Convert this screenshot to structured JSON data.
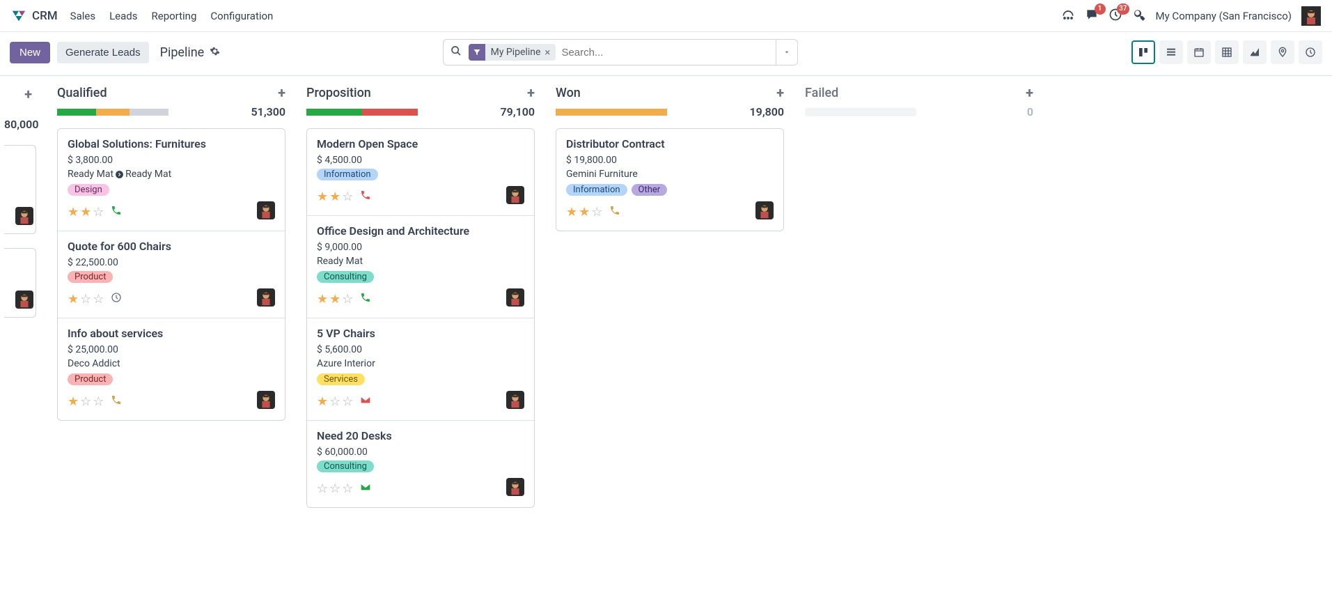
{
  "nav": {
    "app_title": "CRM",
    "links": [
      "Sales",
      "Leads",
      "Reporting",
      "Configuration"
    ],
    "messages_badge": "1",
    "activities_badge": "37",
    "company": "My Company (San Francisco)"
  },
  "control": {
    "new_label": "New",
    "generate_leads_label": "Generate Leads",
    "breadcrumb": "Pipeline",
    "filter_chip": "My Pipeline",
    "search_placeholder": "Search..."
  },
  "partial_col": {
    "total": "80,000"
  },
  "columns": [
    {
      "title": "Qualified",
      "total": "51,300",
      "bar": [
        {
          "color": "green",
          "w": "35%"
        },
        {
          "color": "orange",
          "w": "30%"
        },
        {
          "color": "gray",
          "w": "35%"
        }
      ],
      "cards": [
        {
          "title": "Global Solutions: Furnitures",
          "amount": "$ 3,800.00",
          "customer": "Ready Mat",
          "customer_extra": "Ready Mat",
          "has_external_icon": true,
          "tags": [
            {
              "cls": "tag-design",
              "label": "Design"
            }
          ],
          "stars": 2,
          "icon": "phone",
          "icon_color": "#28a745",
          "has_avatar": true
        },
        {
          "title": "Quote for 600 Chairs",
          "amount": "$ 22,500.00",
          "customer": "",
          "customer_extra": "",
          "has_external_icon": false,
          "tags": [
            {
              "cls": "tag-product",
              "label": "Product"
            }
          ],
          "stars": 1,
          "icon": "clock",
          "icon_color": "#6b7280",
          "has_avatar": true
        },
        {
          "title": "Info about services",
          "amount": "$ 25,000.00",
          "customer": "Deco Addict",
          "customer_extra": "",
          "has_external_icon": false,
          "tags": [
            {
              "cls": "tag-product",
              "label": "Product"
            }
          ],
          "stars": 1,
          "icon": "phone",
          "icon_color": "#d0a24c",
          "has_avatar": true
        }
      ]
    },
    {
      "title": "Proposition",
      "total": "79,100",
      "bar": [
        {
          "color": "green",
          "w": "50%"
        },
        {
          "color": "red",
          "w": "50%"
        }
      ],
      "cards": [
        {
          "title": "Modern Open Space",
          "amount": "$ 4,500.00",
          "customer": "",
          "customer_extra": "",
          "has_external_icon": false,
          "tags": [
            {
              "cls": "tag-info",
              "label": "Information"
            }
          ],
          "stars": 2,
          "icon": "phone",
          "icon_color": "#d9534f",
          "has_avatar": true
        },
        {
          "title": "Office Design and Architecture",
          "amount": "$ 9,000.00",
          "customer": "Ready Mat",
          "customer_extra": "",
          "has_external_icon": false,
          "tags": [
            {
              "cls": "tag-consulting",
              "label": "Consulting"
            }
          ],
          "stars": 2,
          "icon": "phone",
          "icon_color": "#28a745",
          "has_avatar": true
        },
        {
          "title": "5 VP Chairs",
          "amount": "$ 5,600.00",
          "customer": "Azure Interior",
          "customer_extra": "",
          "has_external_icon": false,
          "tags": [
            {
              "cls": "tag-services",
              "label": "Services"
            }
          ],
          "stars": 1,
          "icon": "mail",
          "icon_color": "#d9534f",
          "has_avatar": true
        },
        {
          "title": "Need 20 Desks",
          "amount": "$ 60,000.00",
          "customer": "",
          "customer_extra": "",
          "has_external_icon": false,
          "tags": [
            {
              "cls": "tag-consulting",
              "label": "Consulting"
            }
          ],
          "stars": 0,
          "icon": "mail",
          "icon_color": "#28a745",
          "has_avatar": true
        }
      ]
    },
    {
      "title": "Won",
      "total": "19,800",
      "bar": [
        {
          "color": "orange",
          "w": "100%"
        }
      ],
      "cards": [
        {
          "title": "Distributor Contract",
          "amount": "$ 19,800.00",
          "customer": "Gemini Furniture",
          "customer_extra": "",
          "has_external_icon": false,
          "tags": [
            {
              "cls": "tag-info",
              "label": "Information"
            },
            {
              "cls": "tag-other",
              "label": "Other"
            }
          ],
          "stars": 2,
          "icon": "phone",
          "icon_color": "#d0a24c",
          "has_avatar": true
        }
      ]
    },
    {
      "title": "Failed",
      "total": "0",
      "bar": [],
      "cards": []
    }
  ]
}
